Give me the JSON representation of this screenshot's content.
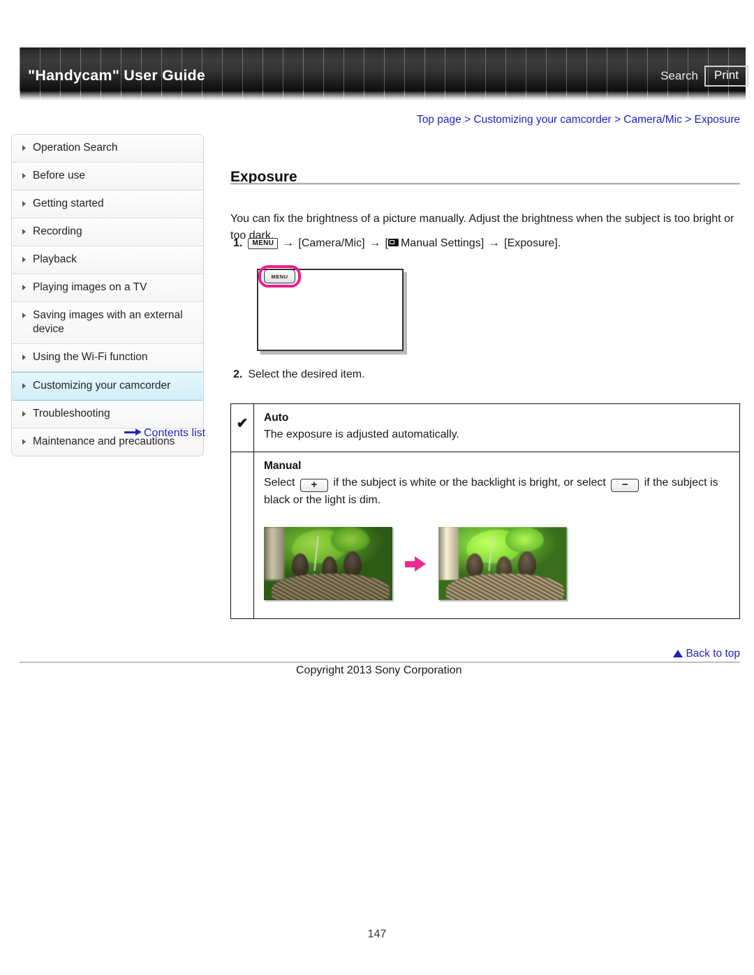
{
  "header": {
    "site_title": "\"Handycam\" User Guide",
    "search_label": "Search",
    "print_label": "Print"
  },
  "sidebar": {
    "items": [
      {
        "label": "Operation Search",
        "selected": false
      },
      {
        "label": "Before use",
        "selected": false
      },
      {
        "label": "Getting started",
        "selected": false
      },
      {
        "label": "Recording",
        "selected": false
      },
      {
        "label": "Playback",
        "selected": false
      },
      {
        "label": "Playing images on a TV",
        "selected": false
      },
      {
        "label": "Saving images with an external device",
        "selected": false
      },
      {
        "label": "Using the Wi-Fi function",
        "selected": false
      },
      {
        "label": "Customizing your camcorder",
        "selected": true
      },
      {
        "label": "Troubleshooting",
        "selected": false
      },
      {
        "label": "Maintenance and precautions",
        "selected": false
      }
    ],
    "contents_link": "Contents list"
  },
  "main": {
    "breadcrumb": "Top page > Customizing your camcorder > Camera/Mic > Exposure",
    "title": "Exposure",
    "intro": "You can fix the brightness of a picture manually. Adjust the brightness when the subject is too bright or too dark.",
    "step1": {
      "number": "1.",
      "menu_chip": "MENU",
      "arrow": "→",
      "part_camera_mic": "[Camera/Mic]",
      "part_manual_open": "[",
      "part_manual_settings": "Manual Settings]",
      "part_exposure": "[Exposure]."
    },
    "step2": {
      "number": "2.",
      "text": "Select the desired item."
    },
    "options": [
      {
        "checked": true,
        "check_glyph": "✔",
        "name": "Auto",
        "desc": "The exposure is adjusted automatically."
      },
      {
        "checked": false,
        "check_glyph": "",
        "name": "Manual",
        "desc_part1": "Select",
        "plus_chip": "+",
        "desc_part2": "if the subject is white or the backlight is bright, or select",
        "minus_chip": "−",
        "desc_part3": "if the subject is black or the light is dim.",
        "photos": {
          "before_alt": "birds-in-nest-dark",
          "after_alt": "birds-in-nest-bright"
        }
      }
    ]
  },
  "footer": {
    "back_to_top": "Back to top",
    "copyright": "Copyright 2013 Sony Corporation",
    "page_number": "147"
  },
  "colors": {
    "link": "#2222bb",
    "highlight_bg": "#d2eef8",
    "highlight_border": "#7fc9e0",
    "pink_accent": "#ea1e8c",
    "header_dark": "#2e2e2e"
  }
}
